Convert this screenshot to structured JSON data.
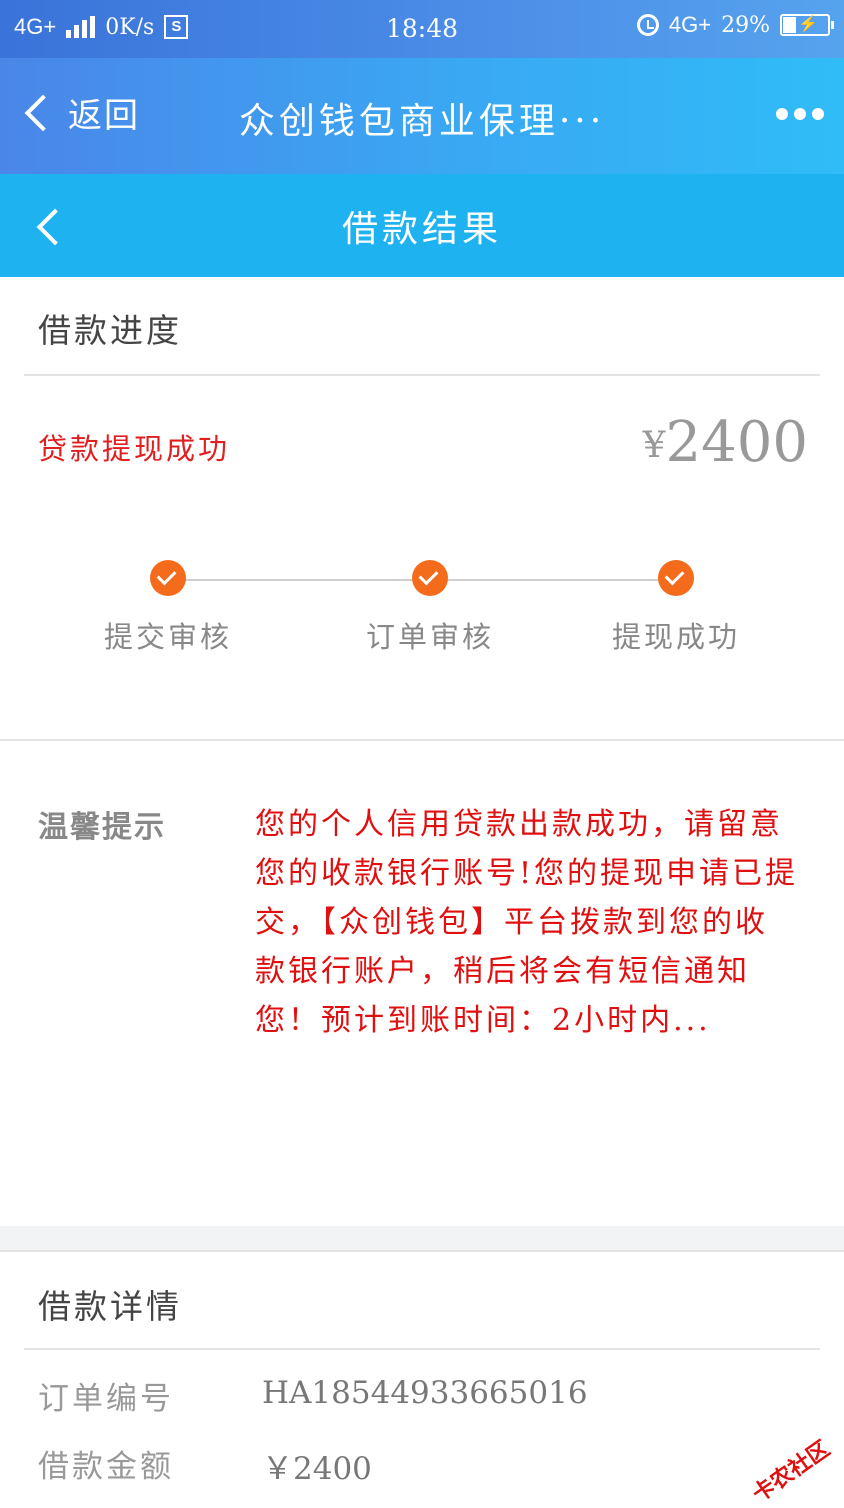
{
  "status_bar": {
    "network": "4G+",
    "speed": "0K/s",
    "time": "18:48",
    "network_right": "4G+",
    "battery": "29%"
  },
  "app_header": {
    "back_label": "返回",
    "title": "众创钱包商业保理···"
  },
  "page_header": {
    "title": "借款结果"
  },
  "progress": {
    "section_title": "借款进度",
    "status_text": "贷款提现成功",
    "currency": "¥",
    "amount": "2400",
    "steps": [
      {
        "label": "提交审核"
      },
      {
        "label": "订单审核"
      },
      {
        "label": "提现成功"
      }
    ]
  },
  "tip": {
    "label": "温馨提示",
    "text": "您的个人信用贷款出款成功，请留意您的收款银行账号!您的提现申请已提交，【众创钱包】平台拨款到您的收款银行账户，稍后将会有短信通知您！预计到账时间：2小时内..."
  },
  "details": {
    "section_title": "借款详情",
    "rows": [
      {
        "label": "订单编号",
        "value": "HA18544933665016"
      },
      {
        "label": "借款金额",
        "value": "￥2400"
      }
    ]
  },
  "watermark": "卡农社区"
}
